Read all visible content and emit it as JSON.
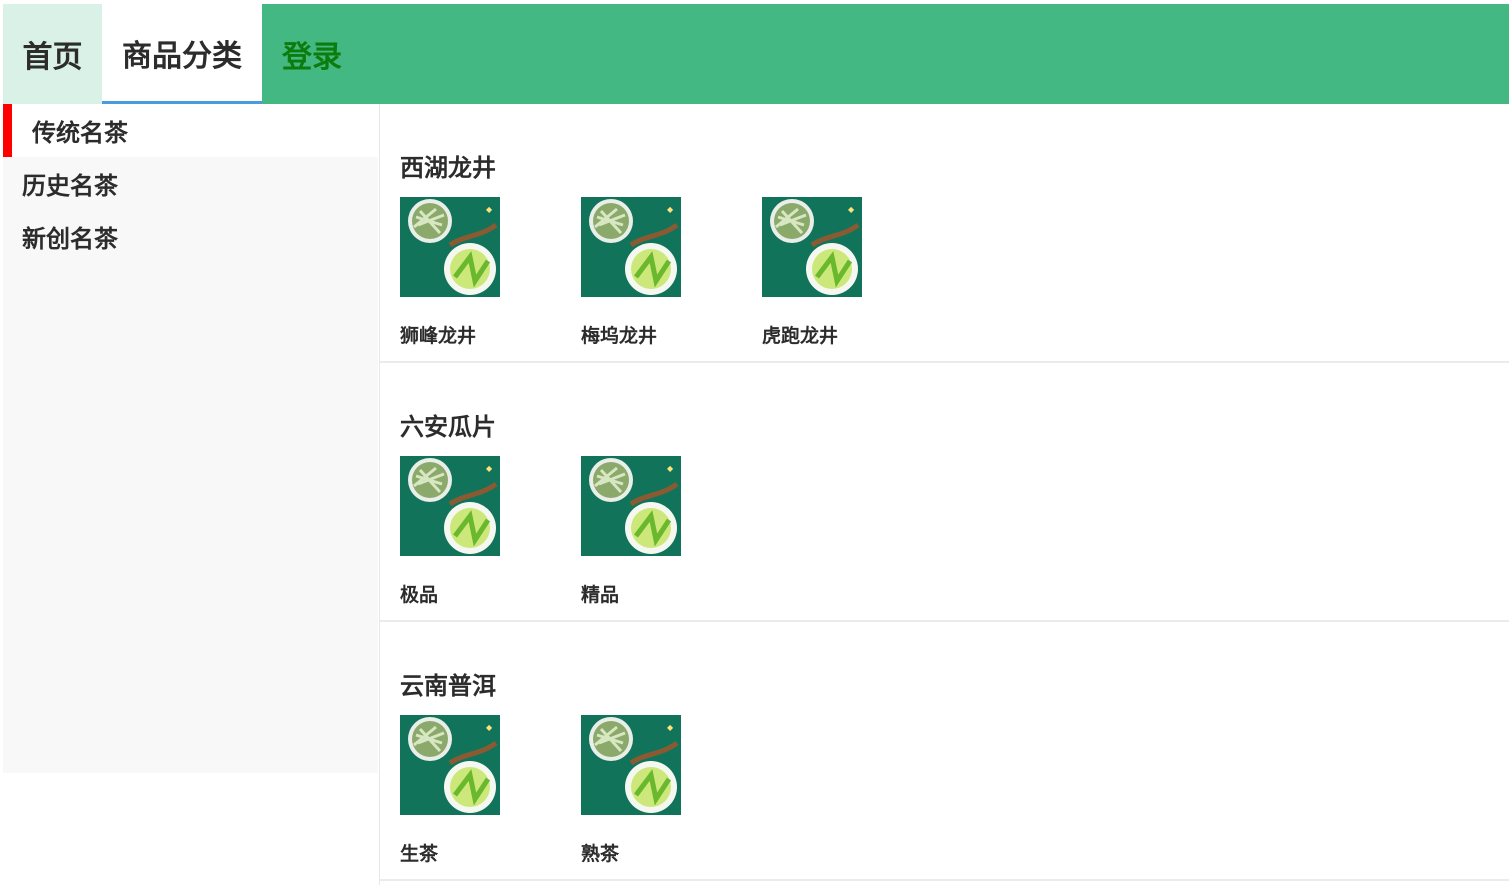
{
  "nav": {
    "home": "首页",
    "category": "商品分类",
    "login": "登录"
  },
  "sidebar": {
    "items": [
      {
        "label": "传统名茶",
        "active": true
      },
      {
        "label": "历史名茶",
        "active": false
      },
      {
        "label": "新创名茶",
        "active": false
      }
    ]
  },
  "sections": [
    {
      "title": "西湖龙井",
      "products": [
        "狮峰龙井",
        "梅坞龙井",
        "虎跑龙井"
      ]
    },
    {
      "title": "六安瓜片",
      "products": [
        "极品",
        "精品"
      ]
    },
    {
      "title": "云南普洱",
      "products": [
        "生茶",
        "熟茶"
      ]
    }
  ],
  "colors": {
    "nav_bg": "#43b883",
    "home_bg": "#d9f1e6",
    "login_text": "#0c7d0c",
    "active_marker": "#ff0000",
    "category_underline": "#4a9ae0"
  },
  "icons": {
    "product_image": "tea-product-image"
  }
}
